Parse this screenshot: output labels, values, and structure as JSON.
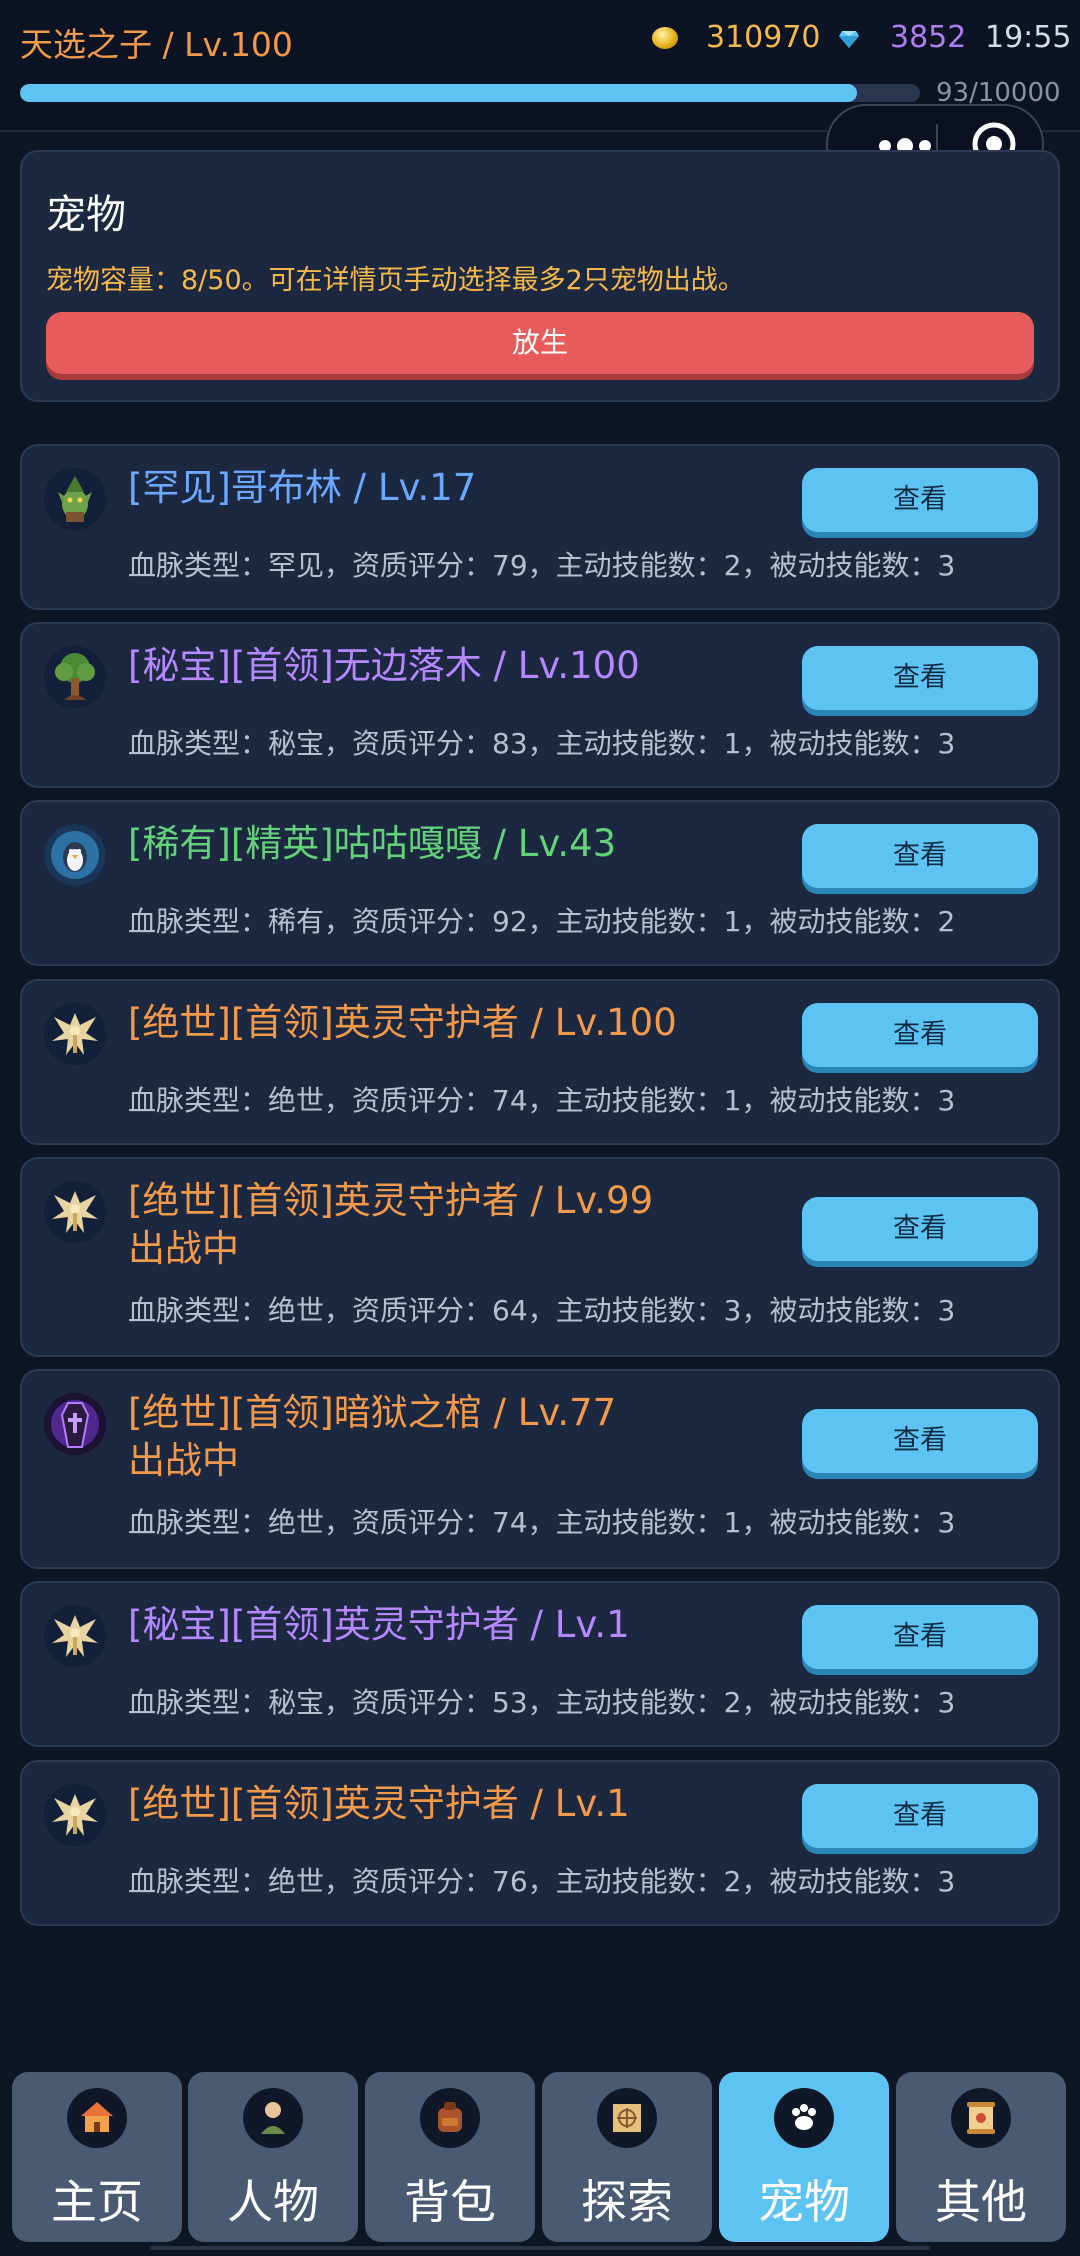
{
  "header": {
    "player": "天选之子 / Lv.100",
    "gold": "310970",
    "gems": "3852",
    "time": "19:55",
    "exp_text": "93/10000",
    "exp_fraction": 0.93
  },
  "icons": {
    "gold": "gold-coin-icon",
    "gem": "diamond-icon",
    "menu": "more-dots-icon",
    "close": "target-circle-icon"
  },
  "panel": {
    "title": "宠物",
    "desc": "宠物容量：8/50。可在详情页手动选择最多2只宠物出战。",
    "release_label": "放生"
  },
  "pets": [
    {
      "name": "[罕见]哥布林 / Lv.17",
      "status": "",
      "stats": "血脉类型：罕见，资质评分：79，主动技能数：2，被动技能数：3",
      "button": "查看",
      "tier": "rare",
      "avatar": "goblin-icon"
    },
    {
      "name": "[秘宝][首领]无边落木 / Lv.100",
      "status": "",
      "stats": "血脉类型：秘宝，资质评分：83，主动技能数：1，被动技能数：3",
      "button": "查看",
      "tier": "treasure",
      "avatar": "tree-icon"
    },
    {
      "name": "[稀有][精英]咕咕嘎嘎 / Lv.43",
      "status": "",
      "stats": "血脉类型：稀有，资质评分：92，主动技能数：1，被动技能数：2",
      "button": "查看",
      "tier": "uncommon",
      "avatar": "penguin-icon"
    },
    {
      "name": "[绝世][首领]英灵守护者 / Lv.100",
      "status": "",
      "stats": "血脉类型：绝世，资质评分：74，主动技能数：1，被动技能数：3",
      "button": "查看",
      "tier": "legend",
      "avatar": "spirit-guardian-icon"
    },
    {
      "name": "[绝世][首领]英灵守护者 / Lv.99",
      "status": "出战中",
      "stats": "血脉类型：绝世，资质评分：64，主动技能数：3，被动技能数：3",
      "button": "查看",
      "tier": "legend",
      "avatar": "spirit-guardian-icon"
    },
    {
      "name": "[绝世][首领]暗狱之棺 / Lv.77",
      "status": "出战中",
      "stats": "血脉类型：绝世，资质评分：74，主动技能数：1，被动技能数：3",
      "button": "查看",
      "tier": "legend",
      "avatar": "coffin-icon"
    },
    {
      "name": "[秘宝][首领]英灵守护者 / Lv.1",
      "status": "",
      "stats": "血脉类型：秘宝，资质评分：53，主动技能数：2，被动技能数：3",
      "button": "查看",
      "tier": "treasure",
      "avatar": "spirit-guardian-icon"
    },
    {
      "name": "[绝世][首领]英灵守护者 / Lv.1",
      "status": "",
      "stats": "血脉类型：绝世，资质评分：76，主动技能数：2，被动技能数：3",
      "button": "查看",
      "tier": "legend",
      "avatar": "spirit-guardian-icon"
    }
  ],
  "nav": [
    {
      "label": "主页",
      "icon": "house-icon",
      "active": false
    },
    {
      "label": "人物",
      "icon": "character-icon",
      "active": false
    },
    {
      "label": "背包",
      "icon": "backpack-icon",
      "active": false
    },
    {
      "label": "探索",
      "icon": "map-scroll-icon",
      "active": false
    },
    {
      "label": "宠物",
      "icon": "paw-icon",
      "active": true
    },
    {
      "label": "其他",
      "icon": "scroll-icon",
      "active": false
    }
  ]
}
